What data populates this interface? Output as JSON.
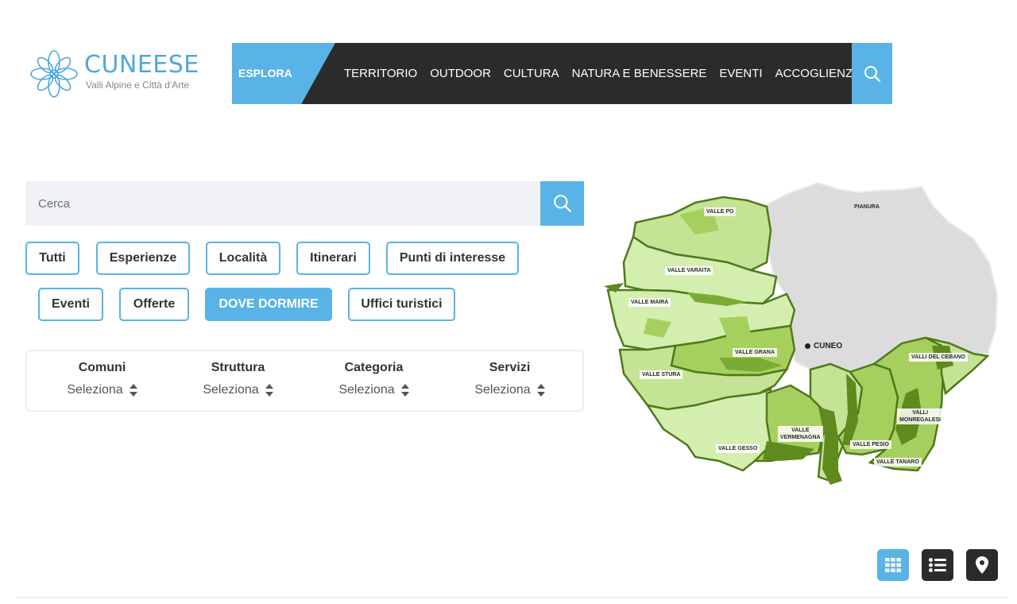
{
  "logo": {
    "brand": "CUNEESE",
    "tagline": "Valli Alpine e Città d'Arte"
  },
  "nav": {
    "explore": "ESPLORA",
    "items": [
      "TERRITORIO",
      "OUTDOOR",
      "CULTURA",
      "NATURA E BENESSERE",
      "EVENTI",
      "ACCOGLIENZA"
    ]
  },
  "search": {
    "placeholder": "Cerca",
    "value": ""
  },
  "filters": {
    "row1": [
      "Tutti",
      "Esperienze",
      "Località",
      "Itinerari",
      "Punti di interesse"
    ],
    "row2": [
      "Eventi",
      "Offerte",
      "DOVE DORMIRE",
      "Uffici turistici"
    ],
    "active": "DOVE DORMIRE"
  },
  "selectors": [
    {
      "title": "Comuni",
      "value": "Seleziona"
    },
    {
      "title": "Struttura",
      "value": "Seleziona"
    },
    {
      "title": "Categoria",
      "value": "Seleziona"
    },
    {
      "title": "Servizi",
      "value": "Seleziona"
    }
  ],
  "map": {
    "city": "CUNEO",
    "regions": {
      "valle_po": "VALLE PO",
      "pianura": "PIANURA",
      "valle_varaita": "VALLE VARAITA",
      "valle_maira": "VALLE MAIRA",
      "valle_grana": "VALLE GRANA",
      "valle_stura": "VALLE STURA",
      "valli_del_cebano": "VALLI DEL CEBANO",
      "valli_monregalesi_1": "VALLI",
      "valli_monregalesi_2": "MONREGALESI",
      "valle_vermenagna_1": "VALLE",
      "valle_vermenagna_2": "VERMENAGNA",
      "valle_pesio": "VALLE PESIO",
      "valle_gesso": "VALLE GESSO",
      "valle_tanaro": "VALLE TANARO"
    }
  },
  "colors": {
    "accent": "#5ab3e6",
    "dark": "#2b2b2b",
    "green_light": "#d4eeb0",
    "green_mid": "#a6d05e",
    "green_dark": "#5e8a1e"
  },
  "icons": {
    "search": "search-icon",
    "grid": "grid-icon",
    "list": "list-icon",
    "map": "map-pin-icon"
  }
}
